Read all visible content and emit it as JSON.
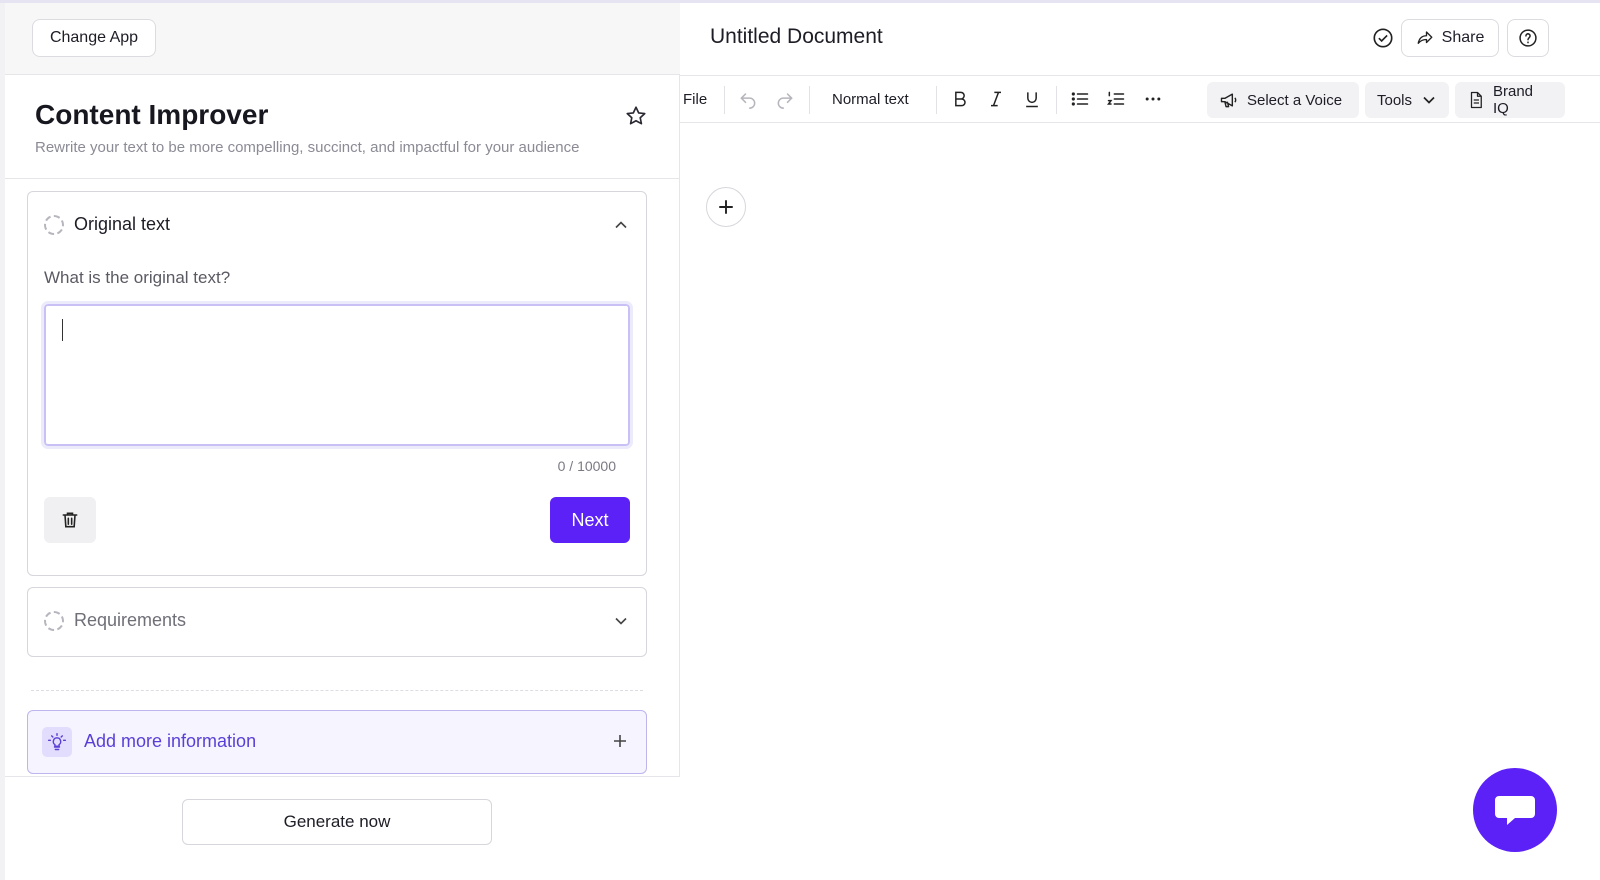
{
  "left_panel": {
    "change_app_label": "Change App",
    "app_title": "Content Improver",
    "app_subtitle": "Rewrite your text to be more compelling, succinct, and impactful for your audience",
    "sections": {
      "original": {
        "title": "Original text",
        "question": "What is the original text?",
        "value": "",
        "counter": "0 / 10000",
        "next_label": "Next"
      },
      "requirements": {
        "title": "Requirements"
      }
    },
    "add_more_label": "Add more information",
    "generate_label": "Generate now"
  },
  "document": {
    "title": "Untitled Document",
    "share_label": "Share",
    "toolbar": {
      "file": "File",
      "style": "Normal text",
      "voice": "Select a Voice",
      "tools": "Tools",
      "brand": "Brand IQ"
    }
  },
  "colors": {
    "accent": "#5b21f6",
    "accent_light": "#f6f4ff"
  },
  "icons": [
    "star-icon",
    "dashed-circle-icon",
    "chevron-up-icon",
    "chevron-down-icon",
    "trash-icon",
    "lightbulb-icon",
    "plus-icon",
    "check-circle-icon",
    "share-icon",
    "help-icon",
    "undo-icon",
    "redo-icon",
    "bold-icon",
    "italic-icon",
    "underline-icon",
    "bullet-list-icon",
    "numbered-list-icon",
    "more-icon",
    "megaphone-icon",
    "document-icon",
    "chat-icon"
  ]
}
